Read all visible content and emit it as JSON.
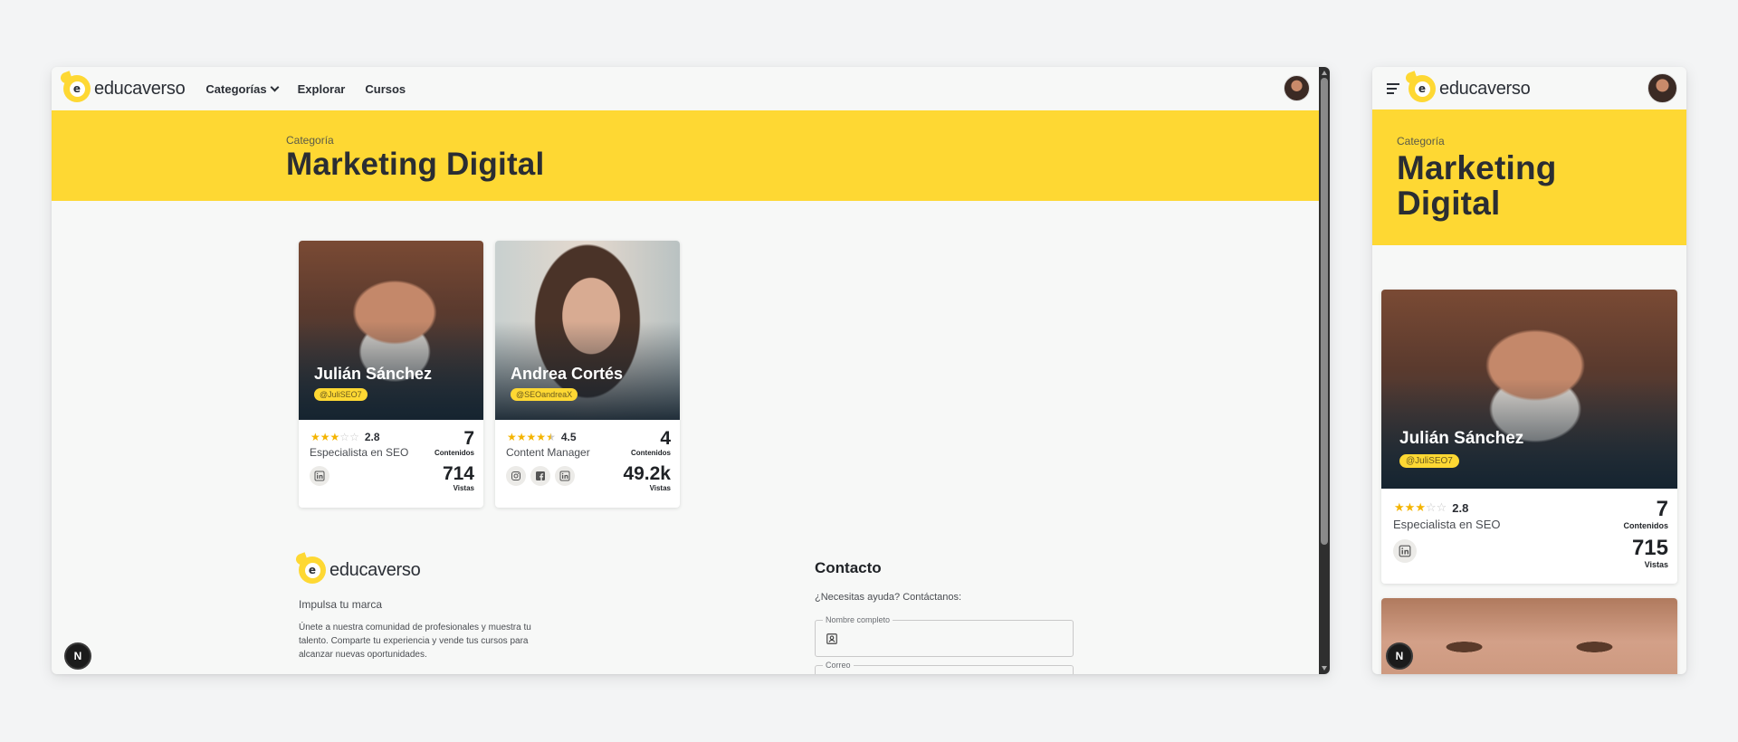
{
  "brand": {
    "name": "educaverso",
    "mark_letter": "e",
    "accent": "#fed833",
    "dark": "#2a2d33"
  },
  "nav": {
    "categories": "Categorías",
    "explore": "Explorar",
    "courses": "Cursos"
  },
  "banner": {
    "kicker": "Categoría",
    "title": "Marketing Digital"
  },
  "cards": [
    {
      "name": "Julián Sánchez",
      "handle": "@JuliSEO7",
      "rating": "2.8",
      "stars_filled": 3,
      "role": "Especialista en SEO",
      "contents": "7",
      "contents_label": "Contenidos",
      "views": "714",
      "views_label": "Vistas",
      "socials": [
        "linkedin-icon"
      ]
    },
    {
      "name": "Andrea Cortés",
      "handle": "@SEOandreaX",
      "rating": "4.5",
      "stars_filled": 4.5,
      "role": "Content Manager",
      "contents": "4",
      "contents_label": "Contenidos",
      "views": "49.2k",
      "views_label": "Vistas",
      "socials": [
        "instagram-icon",
        "facebook-icon",
        "linkedin-icon"
      ]
    }
  ],
  "mobile_card": {
    "name": "Julián Sánchez",
    "handle": "@JuliSEO7",
    "rating": "2.8",
    "role": "Especialista en SEO",
    "contents": "7",
    "contents_label": "Contenidos",
    "views": "715",
    "views_label": "Vistas"
  },
  "footer": {
    "tagline": "Impulsa tu marca",
    "description": "Únete a nuestra comunidad de profesionales y muestra tu talento. Comparte tu experiencia y vende tus cursos para alcanzar nuevas oportunidades.",
    "contact_title": "Contacto",
    "contact_prompt": "¿Necesitas ayuda? Contáctanos:",
    "name_field_label": "Nombre completo",
    "email_field_label": "Correo"
  },
  "fab_letter": "N"
}
